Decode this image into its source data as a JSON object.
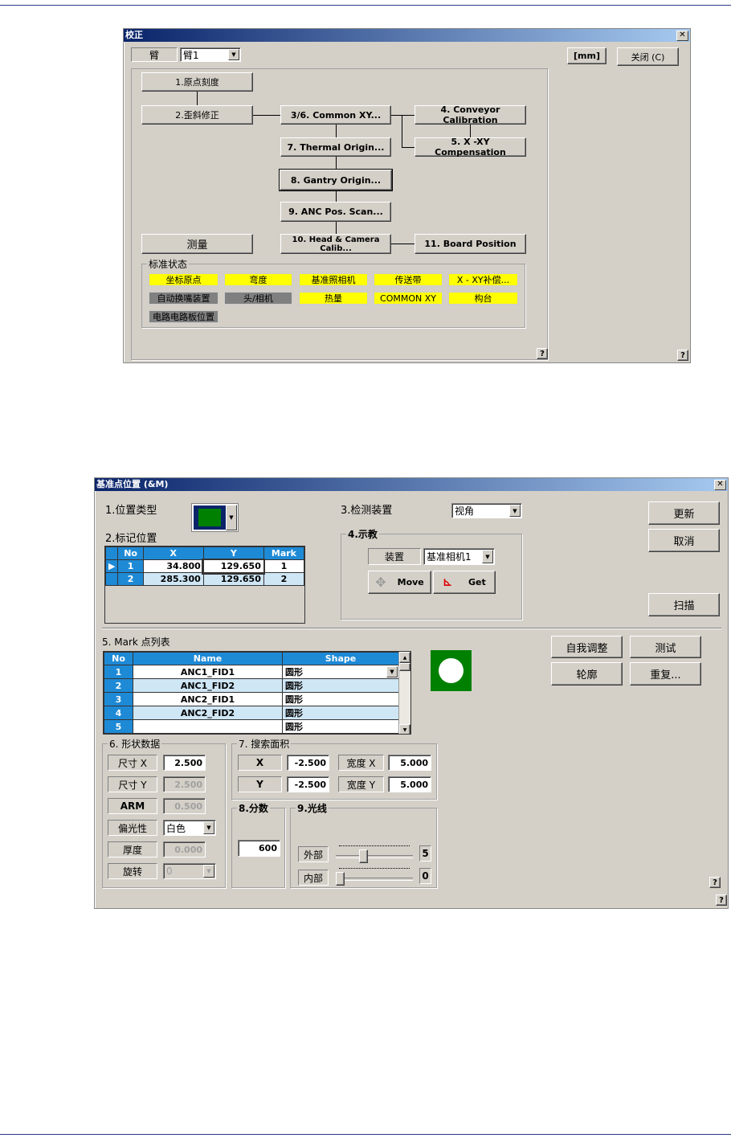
{
  "calib": {
    "title": "校正",
    "arm_label": "臂",
    "arm_value": "臂1",
    "unit": "[mm]",
    "close": "关闭 (C)",
    "help": "?",
    "steps": {
      "s1": "1.原点刻度",
      "s2": "2.歪斜修正",
      "s3": "3/6. Common XY...",
      "s4": "4. Conveyor Calibration",
      "s5": "5. X -XY Compensation",
      "s7": "7. Thermal Origin...",
      "s8": "8. Gantry Origin...",
      "s9": "9. ANC Pos. Scan...",
      "measure": "测量",
      "s10": "10. Head & Camera Calib...",
      "s11": "11. Board Position"
    },
    "status_title": "标准状态",
    "status": [
      {
        "label": "坐标原点",
        "color": "#ffff00"
      },
      {
        "label": "弯度",
        "color": "#ffff00"
      },
      {
        "label": "基准照相机",
        "color": "#ffff00"
      },
      {
        "label": "传送带",
        "color": "#ffff00"
      },
      {
        "label": "X - XY补偿...",
        "color": "#ffff00"
      },
      {
        "label": "自动换嘴装置",
        "color": "#808080"
      },
      {
        "label": "头/相机",
        "color": "#808080"
      },
      {
        "label": "热量",
        "color": "#ffff00"
      },
      {
        "label": "COMMON XY",
        "color": "#ffff00"
      },
      {
        "label": "构台",
        "color": "#ffff00"
      },
      {
        "label": "电路电路板位置",
        "color": "#808080"
      }
    ]
  },
  "fid": {
    "title": "基准点位置 (&M)",
    "pos_type": "1.位置类型",
    "mark_pos": "2.标记位置",
    "detect": "3.检测装置",
    "detect_value": "视角",
    "teach": "4.示教",
    "device_label": "装置",
    "device_value": "基准相机1",
    "move": "Move",
    "get": "Get",
    "update": "更新",
    "cancel": "取消",
    "scan": "扫描",
    "self_adjust": "自我调整",
    "test": "测试",
    "contour": "轮廓",
    "repeat": "重复...",
    "pos_headers": [
      "No",
      "X",
      "Y",
      "Mark"
    ],
    "pos_rows": [
      [
        "1",
        "34.800",
        "129.650",
        "1"
      ],
      [
        "2",
        "285.300",
        "129.650",
        "2"
      ]
    ],
    "list_title": "5. Mark 点列表",
    "list_headers": [
      "No",
      "Name",
      "Shape"
    ],
    "list_rows": [
      [
        "1",
        "ANC1_FID1",
        "圆形"
      ],
      [
        "2",
        "ANC1_FID2",
        "圆形"
      ],
      [
        "3",
        "ANC2_FID1",
        "圆形"
      ],
      [
        "4",
        "ANC2_FID2",
        "圆形"
      ],
      [
        "5",
        "",
        "圆形"
      ]
    ],
    "shape_title": "6. 形状数据",
    "shape": [
      {
        "label": "尺寸 X",
        "value": "2.500"
      },
      {
        "label": "尺寸 Y",
        "value": "2.500"
      },
      {
        "label": "ARM",
        "value": "0.500"
      },
      {
        "label": "偏光性",
        "value": "白色"
      },
      {
        "label": "厚度",
        "value": "0.000"
      },
      {
        "label": "旋转",
        "value": "0"
      }
    ],
    "search_title": "7. 搜索面积",
    "sx_label": "X",
    "sx": "-2.500",
    "sy_label": "Y",
    "sy": "-2.500",
    "wx_label": "宽度 X",
    "wx": "5.000",
    "wy_label": "宽度 Y",
    "wy": "5.000",
    "score_title": "8.分数",
    "score": "600",
    "light_title": "9.光线",
    "outer_label": "外部",
    "outer": "5",
    "inner_label": "内部",
    "inner": "0",
    "help": "?"
  }
}
